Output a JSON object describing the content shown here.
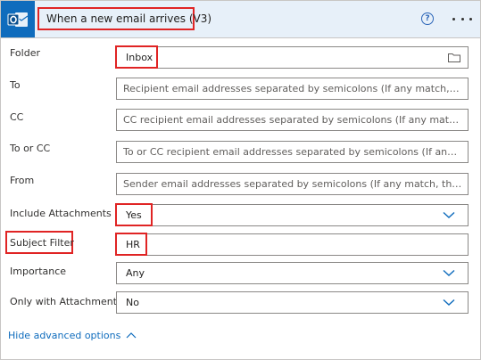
{
  "header": {
    "title": "When a new email arrives (V3)",
    "app_icon": "outlook-icon",
    "help_icon": "help-circle-icon",
    "help_symbol": "?",
    "more_icon": "more-horizontal-icon"
  },
  "fields": {
    "folder": {
      "label": "Folder",
      "value": "Inbox"
    },
    "to": {
      "label": "To",
      "placeholder": "Recipient email addresses separated by semicolons (If any match, t..."
    },
    "cc": {
      "label": "CC",
      "placeholder": "CC recipient email addresses separated by semicolons (If any matc..."
    },
    "to_or_cc": {
      "label": "To or CC",
      "placeholder": "To or CC recipient email addresses separated by semicolons (If any ..."
    },
    "from": {
      "label": "From",
      "placeholder": "Sender email addresses separated by semicolons (If any match, the..."
    },
    "include_attachments": {
      "label": "Include Attachments",
      "value": "Yes"
    },
    "subject_filter": {
      "label": "Subject Filter",
      "value": "HR"
    },
    "importance": {
      "label": "Importance",
      "value": "Any"
    },
    "only_with_attachments": {
      "label": "Only with Attachments",
      "value": "No"
    }
  },
  "advanced": {
    "label": "Hide advanced options"
  },
  "colors": {
    "accent": "#0f6cbd",
    "highlight": "#e02424",
    "header_bg": "#e7f0f9"
  }
}
